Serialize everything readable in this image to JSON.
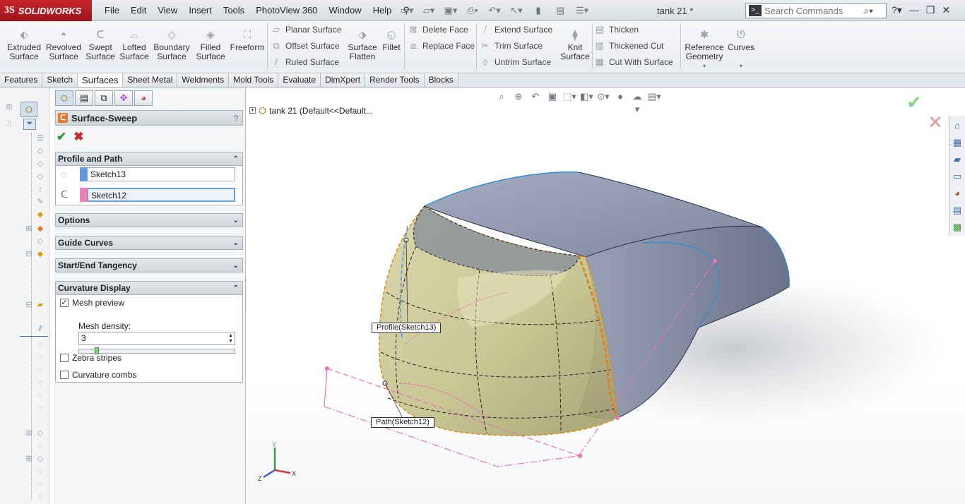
{
  "app": {
    "logo": "SOLIDWORKS",
    "logo_prefix": "3S",
    "doc_title": "tank 21 *"
  },
  "menu": [
    "File",
    "Edit",
    "View",
    "Insert",
    "Tools",
    "PhotoView 360",
    "Window",
    "Help"
  ],
  "search": {
    "placeholder": "Search Commands"
  },
  "ribbon": {
    "extruded": "Extruded Surface",
    "revolved": "Revolved Surface",
    "swept": "Swept Surface",
    "lofted": "Lofted Surface",
    "boundary": "Boundary Surface",
    "filled": "Filled Surface",
    "freeform": "Freeform",
    "planar": "Planar Surface",
    "offset": "Offset Surface",
    "ruled": "Ruled Surface",
    "flatten": "Surface Flatten",
    "fillet": "Fillet",
    "delete_face": "Delete Face",
    "replace_face": "Replace Face",
    "extend": "Extend Surface",
    "trim": "Trim Surface",
    "untrim": "Untrim Surface",
    "knit": "Knit Surface",
    "thicken": "Thicken",
    "thickened_cut": "Thickened Cut",
    "cut_with_surface": "Cut With Surface",
    "reference_geometry": "Reference Geometry",
    "curves": "Curves"
  },
  "tabs": [
    "Features",
    "Sketch",
    "Surfaces",
    "Sheet Metal",
    "Weldments",
    "Mold Tools",
    "Evaluate",
    "DimXpert",
    "Render Tools",
    "Blocks"
  ],
  "active_tab": "Surfaces",
  "pm": {
    "title": "Surface-Sweep",
    "help": "?",
    "profile_path": {
      "header": "Profile and Path",
      "profile": "Sketch13",
      "path": "Sketch12",
      "profile_color": "#5b9be4",
      "path_color": "#f07fb5"
    },
    "options": "Options",
    "guide_curves": "Guide Curves",
    "tangency": "Start/End Tangency",
    "curvature": {
      "header": "Curvature Display",
      "mesh_preview": "Mesh preview",
      "mesh_preview_checked": true,
      "mesh_density_label": "Mesh density:",
      "mesh_density": "3",
      "zebra": "Zebra stripes",
      "combs": "Curvature combs"
    }
  },
  "viewport": {
    "tree_root": "tank 21  (Default<<Default...",
    "profile_callout": "Profile(Sketch13)",
    "path_callout": "Path(Sketch12)",
    "triad": {
      "x": "X",
      "y": "Y",
      "z": "Z"
    }
  },
  "colors": {
    "body": "#8e97ad",
    "sweep": "#c9c58e",
    "edge": "#2e8fd6",
    "sketch": "#ea74b4",
    "accent": "#c8262e"
  }
}
